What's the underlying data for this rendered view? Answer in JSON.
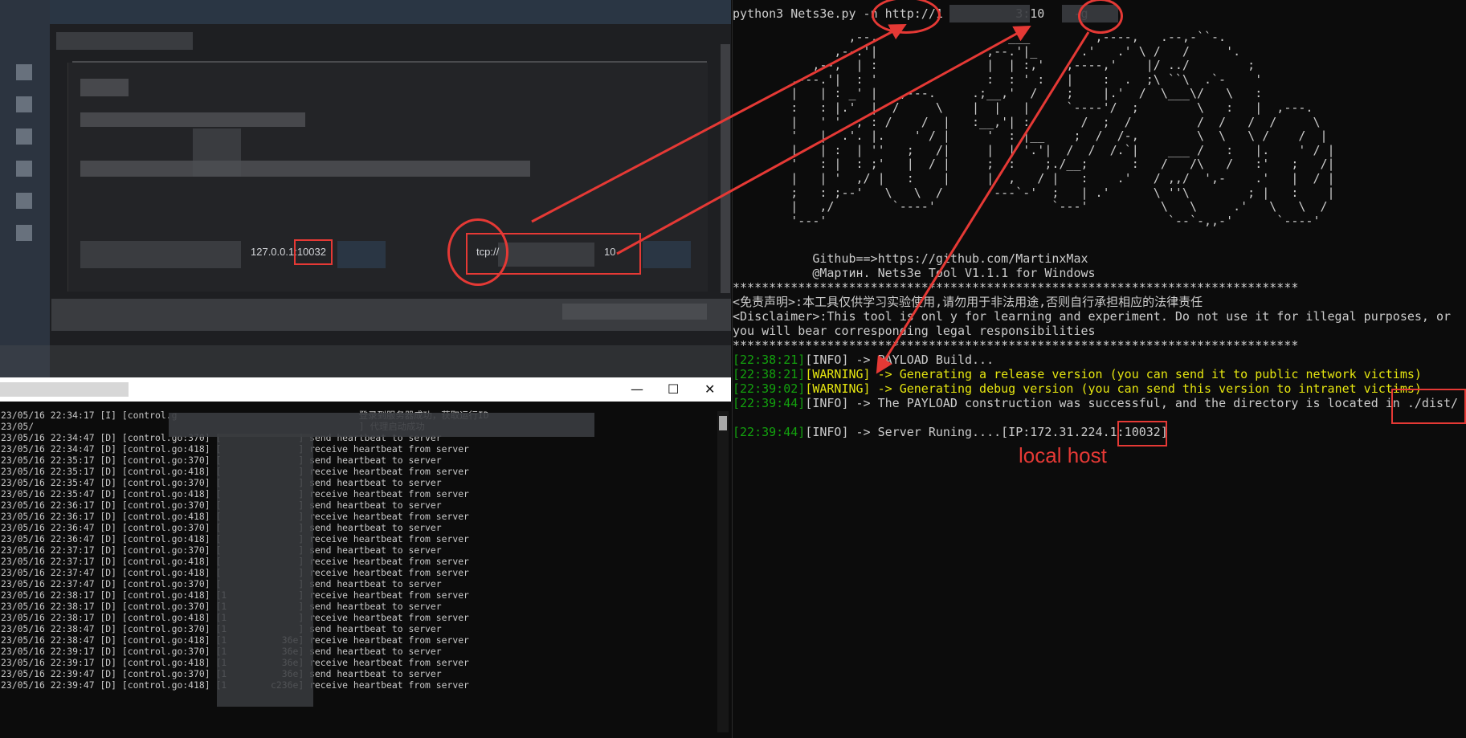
{
  "gui": {
    "listen_addr": "127.0.0.1:10032",
    "tunnel_prefix": "tcp://",
    "tunnel_suffix": "10"
  },
  "console": {
    "window_controls": {
      "minimize": "—",
      "maximize": "☐",
      "close": "✕"
    },
    "lines": [
      "23/05/16 22:34:17 [I] [control.g                                 登录到服务器成功，获取运行ID",
      "23/05/                                                           ] 代理启动成功",
      "23/05/16 22:34:47 [D] [control.go:370] [              ] send heartbeat to server",
      "23/05/16 22:34:47 [D] [control.go:418] [              ] receive heartbeat from server",
      "23/05/16 22:35:17 [D] [control.go:370] [              ] send heartbeat to server",
      "23/05/16 22:35:17 [D] [control.go:418] [              ] receive heartbeat from server",
      "23/05/16 22:35:47 [D] [control.go:370] [              ] send heartbeat to server",
      "23/05/16 22:35:47 [D] [control.go:418] [              ] receive heartbeat from server",
      "23/05/16 22:36:17 [D] [control.go:370] [              ] send heartbeat to server",
      "23/05/16 22:36:17 [D] [control.go:418] [              ] receive heartbeat from server",
      "23/05/16 22:36:47 [D] [control.go:370] [              ] send heartbeat to server",
      "23/05/16 22:36:47 [D] [control.go:418] [              ] receive heartbeat from server",
      "23/05/16 22:37:17 [D] [control.go:370] [              ] send heartbeat to server",
      "23/05/16 22:37:17 [D] [control.go:418] [              ] receive heartbeat from server",
      "23/05/16 22:37:47 [D] [control.go:418] [              ] receive heartbeat from server",
      "23/05/16 22:37:47 [D] [control.go:370] [              ] send heartbeat to server",
      "23/05/16 22:38:17 [D] [control.go:418] [1             ] receive heartbeat from server",
      "23/05/16 22:38:17 [D] [control.go:370] [1             ] send heartbeat to server",
      "23/05/16 22:38:17 [D] [control.go:418] [1             ] receive heartbeat from server",
      "23/05/16 22:38:47 [D] [control.go:370] [1             ] send heartbeat to server",
      "23/05/16 22:38:47 [D] [control.go:418] [1          36e] receive heartbeat from server",
      "23/05/16 22:39:17 [D] [control.go:370] [1          36e] send heartbeat to server",
      "23/05/16 22:39:17 [D] [control.go:418] [1          36e] receive heartbeat from server",
      "23/05/16 22:39:47 [D] [control.go:370] [1          36e] send heartbeat to server",
      "23/05/16 22:39:47 [D] [control.go:418] [1        c236e] receive heartbeat from server"
    ]
  },
  "terminal": {
    "command": "python3 Nets3e.py -n http://1          3:10    -g",
    "ascii_banner": "                ,--,                  ___         ,----,   .--,-``-.            \n              ,--.'|               ,--.'|_      .'   .' \\ /   /     '.          \n           ,--,  | :               |  | :,'   ,----,'    |/ ../        ;         \n        ,---.'|  : '               :  : ' :   |    :  .  ;\\ ``\\  .`-    '         \n        |   | : _' |   ,---.     .;__,'  /    ;    |.'  /  \\___\\/   \\   :         \n        :   : |.'  |  /     \\    |  |   |     `----'/  ;        \\   :   |  ,---.  \n        |   ' '  ; : /    /  |   :__,'| :       /  ;  /         /  /   /  /     \\ \n        '   |  .'. |.    ' / |     '  : |__    ;  /  /-,        \\  \\   \\ /    /  |\n        |   | :  | ''   ;   /|     |  | '.'|  /  /  /.`|    ___ /   :   |.    ' / |\n        '   : |  : ;'   |  / |     ;  :    ;./__;      :   /   /\\   /   :'   ;   /|\n        |   | '  ,/ |   :    |     |  ,   / |   :    .'   / ,,/  ',-    .'   |  / |\n        ;   : ;--'   \\   \\  /       ---`-'  ;   | .'      \\ ''\\        ; |   :    |\n        |   ,/        `----'                `---'          \\   \\     .'   \\   \\  / \n        '---'                                               `--`-,,-'      `----'  ",
    "github_line": "           Github==>https://github.com/MartinxMax",
    "author_line": "           @Мартин. Nets3e Tool V1.1.1 for Windows",
    "stars": "******************************************************************************",
    "disclaimer_cn": "<免责声明>:本工具仅供学习实验使用,请勿用于非法用途,否则自行承担相应的法律责任",
    "disclaimer_en_1": "<Disclaimer>:This tool is onl y for learning and experiment. Do not use it for illegal purposes, or",
    "disclaimer_en_2": "you will bear corresponding legal responsibilities",
    "log": [
      {
        "time": "[22:38:21]",
        "level": "[INFO]",
        "msg": " -> PAYLOAD Build..."
      },
      {
        "time": "[22:38:21]",
        "level": "[WARNING]",
        "msg": " -> Generating a release version (you can send it to public network victims)"
      },
      {
        "time": "[22:39:02]",
        "level": "[WARNING]",
        "msg": " -> Generating debug version (you can send this version to intranet victims)"
      },
      {
        "time": "[22:39:44]",
        "level": "[INFO]",
        "msg": " -> The PAYLOAD construction was successful, and the directory is located in ./dist/"
      },
      {
        "time": "[22:39:44]",
        "level": "[INFO]",
        "msg": " -> Server Runing....[IP:172.31.224.1:10032]"
      }
    ]
  },
  "annotations": {
    "local_host_label": "local host"
  }
}
